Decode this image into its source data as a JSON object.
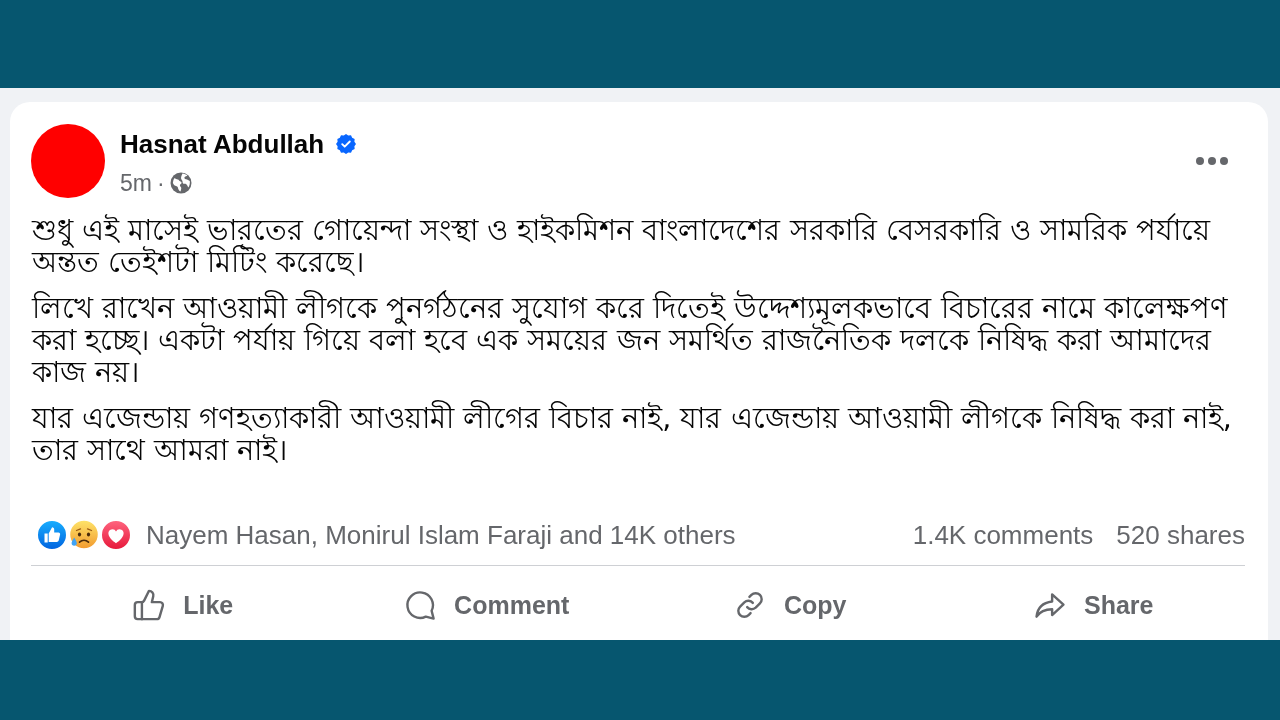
{
  "post": {
    "author": {
      "name": "Hasnat Abdullah",
      "verified": true
    },
    "time": "5m",
    "separator": "·",
    "paragraphs": [
      "শুধু এই মাসেই ভারতের গোয়েন্দা সংস্থা ও হাইকমিশন বাংলাদেশের সরকারি বেসরকারি ও সামরিক পর্যায়ে অন্তত তেইশটা মিটিং করেছে।",
      "লিখে রাখেন আওয়ামী লীগকে পুনর্গঠনের সুযোগ করে দিতেই উদ্দেশ্যমূলকভাবে বিচারের নামে কালেক্ষপণ করা হচ্ছে। একটা পর্যায় গিয়ে বলা হবে এক সময়ের জন সমর্থিত রাজনৈতিক দলকে নিষিদ্ধ করা আমাদের কাজ নয়।",
      "যার এজেন্ডায় গণহত্যাকারী আওয়ামী লীগের বিচার নাই, যার এজেন্ডায় আওয়ামী লীগকে নিষিদ্ধ করা নাই, তার সাথে আমরা নাই।"
    ],
    "reactions": [
      {
        "kind": "like"
      },
      {
        "kind": "sad"
      },
      {
        "kind": "love"
      }
    ],
    "reaction_summary": "Nayem Hasan, Monirul Islam Faraji and 14K others",
    "comments": "1.4K comments",
    "shares": "520 shares",
    "actions": [
      {
        "kind": "like",
        "label": "Like"
      },
      {
        "kind": "comment",
        "label": "Comment"
      },
      {
        "kind": "copy",
        "label": "Copy"
      },
      {
        "kind": "share",
        "label": "Share"
      }
    ]
  }
}
